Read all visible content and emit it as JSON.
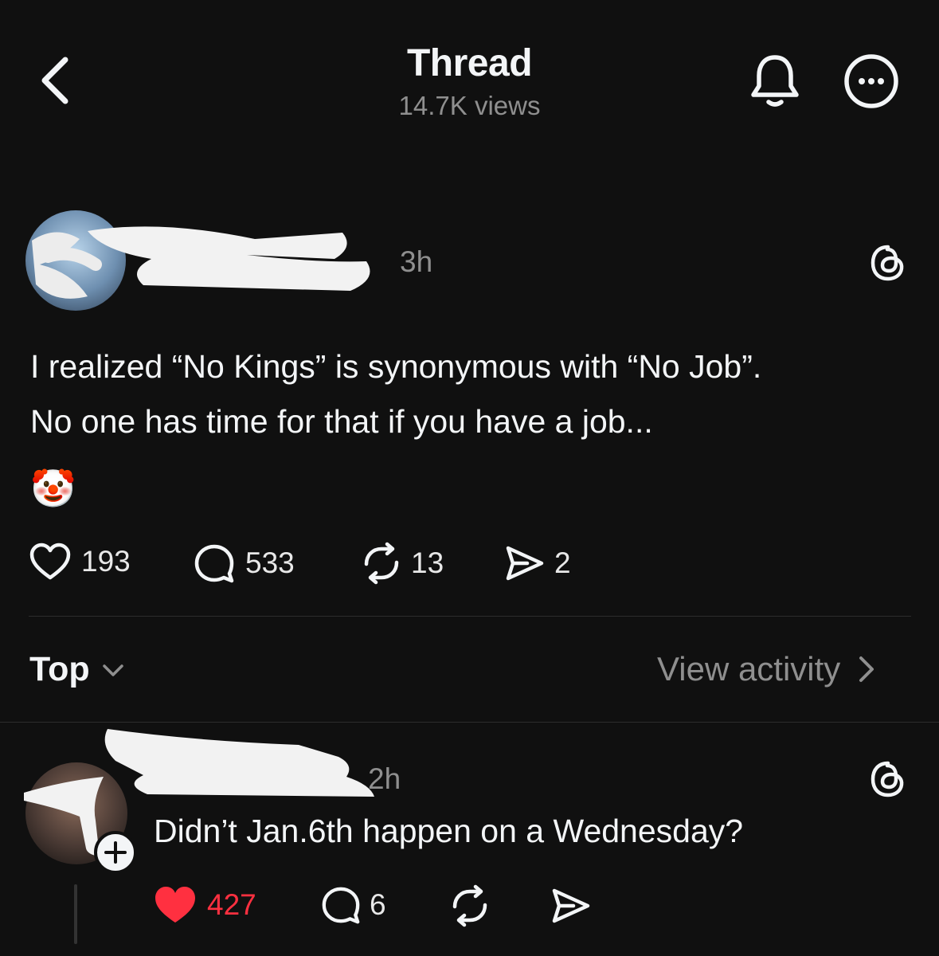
{
  "header": {
    "title": "Thread",
    "views": "14.7K views"
  },
  "post": {
    "timestamp": "3h",
    "text_line1": "I realized “No Kings” is synonymous with “No Job”.",
    "text_line2": "No one has time for that if you have a job...",
    "emoji": "🤡",
    "likes": "193",
    "replies": "533",
    "reposts": "13",
    "shares": "2"
  },
  "sort": {
    "label": "Top",
    "view_activity": "View activity"
  },
  "reply": {
    "timestamp": "2h",
    "text": "Didn’t Jan.6th happen on a Wednesday?",
    "likes": "427",
    "replies": "6",
    "liked": true
  },
  "colors": {
    "background": "#101010",
    "text": "#f3f5f7",
    "muted": "#8f8f8f",
    "like_active": "#ff3040"
  },
  "icons": [
    "back-chevron-icon",
    "bell-icon",
    "more-icon",
    "threads-logo-icon",
    "heart-icon",
    "comment-icon",
    "repost-icon",
    "share-icon",
    "chevron-down-icon",
    "chevron-right-icon",
    "follow-plus-icon"
  ]
}
